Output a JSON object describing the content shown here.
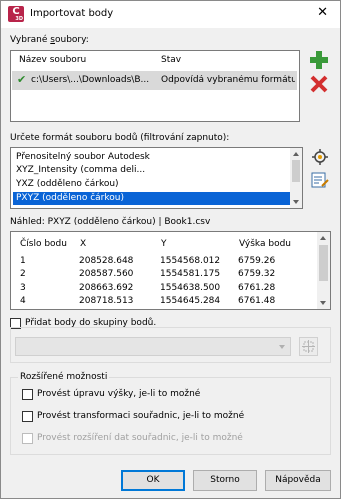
{
  "window": {
    "title": "Importovat body",
    "app_icon_letter": "C",
    "app_icon_sub": "3D"
  },
  "selected_files": {
    "label_prefix": "Vybrané ",
    "label_hot": "s",
    "label_suffix": "oubory:",
    "columns": [
      "Název souboru",
      "Stav"
    ],
    "rows": [
      {
        "name": "c:\\Users\\​...\\Downloads\\B...",
        "status": "Odpovídá vybranému formátu..."
      }
    ]
  },
  "format": {
    "label": "Určete formát souboru bodů (filtrování zapnuto):",
    "items": [
      "Přenositelný soubor Autodesk",
      "XYZ_Intensity (comma deli...",
      "YXZ (odděleno čárkou)",
      "PXYZ (odděleno čárkou)"
    ],
    "selected_index": 3
  },
  "preview": {
    "label": "Náhled: PXYZ (odděleno čárkou) | Book1.csv",
    "columns": [
      "Číslo bodu",
      "X",
      "Y",
      "Výška bodu"
    ],
    "rows": [
      [
        "1",
        "208528.648",
        "1554568.012",
        "6759.26"
      ],
      [
        "2",
        "208587.560",
        "1554581.175",
        "6759.32"
      ],
      [
        "3",
        "208663.692",
        "1554638.500",
        "6761.28"
      ],
      [
        "4",
        "208718.513",
        "1554645.284",
        "6761.48"
      ]
    ]
  },
  "add_to_group": {
    "label": "Přidat body do skupiny bodů.",
    "checked": false
  },
  "advanced": {
    "label": "Rozšířené možnosti",
    "options": [
      {
        "label": "Provést úpravu výšky, je-li to možné",
        "enabled": true
      },
      {
        "label": "Provést transformaci souřadnic, je-li to možné",
        "enabled": true
      },
      {
        "label": "Provést rozšíření dat souřadnic, je-li to možné",
        "enabled": false
      }
    ]
  },
  "buttons": {
    "ok": "OK",
    "cancel": "Storno",
    "help": "Nápověda"
  },
  "colors": {
    "accent": "#0a64d6",
    "add_green": "#3a9a3a",
    "remove_red": "#d32f2f",
    "app_icon": "#b8244a"
  }
}
